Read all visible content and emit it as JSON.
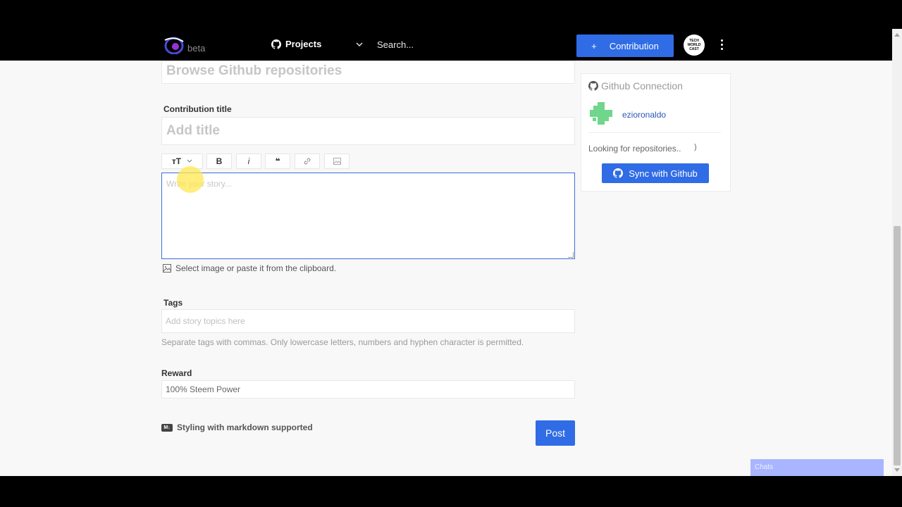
{
  "header": {
    "beta_label": "beta",
    "projects_label": "Projects",
    "search_placeholder": "Search...",
    "contribution_button": "Contribution",
    "contribution_plus": "+",
    "avatar_text": "TECH WORLD CAST"
  },
  "form": {
    "repo_placeholder": "Browse Github repositories",
    "title_label": "Contribution title",
    "title_placeholder": "Add title",
    "toolbar": {
      "heading": "ᴛT",
      "bold": "B",
      "italic": "i",
      "quote": "❝"
    },
    "editor_placeholder": "Write your story...",
    "image_hint": "Select image or paste it from the clipboard.",
    "tags_label": "Tags",
    "tags_placeholder": "Add story topics here",
    "tags_hint": "Separate tags with commas. Only lowercase letters, numbers and hyphen character is permitted.",
    "reward_label": "Reward",
    "reward_value": "100% Steem Power",
    "markdown_icon": "M↓",
    "markdown_note": "Styling with markdown supported",
    "post_button": "Post"
  },
  "github_card": {
    "title": "Github Connection",
    "username": "ezioronaldo",
    "status": "Looking for repositories..",
    "spinner": ")",
    "sync_button": "Sync with Github"
  },
  "chats": {
    "label": "Chats"
  },
  "colors": {
    "accent": "#2f6ce5",
    "link": "#2a55b8",
    "background": "#f8f8f8"
  },
  "icons": [
    "logo-icon",
    "github-icon",
    "chevron-down-icon",
    "kebab-icon",
    "link-icon",
    "image-icon",
    "markdown-icon"
  ]
}
